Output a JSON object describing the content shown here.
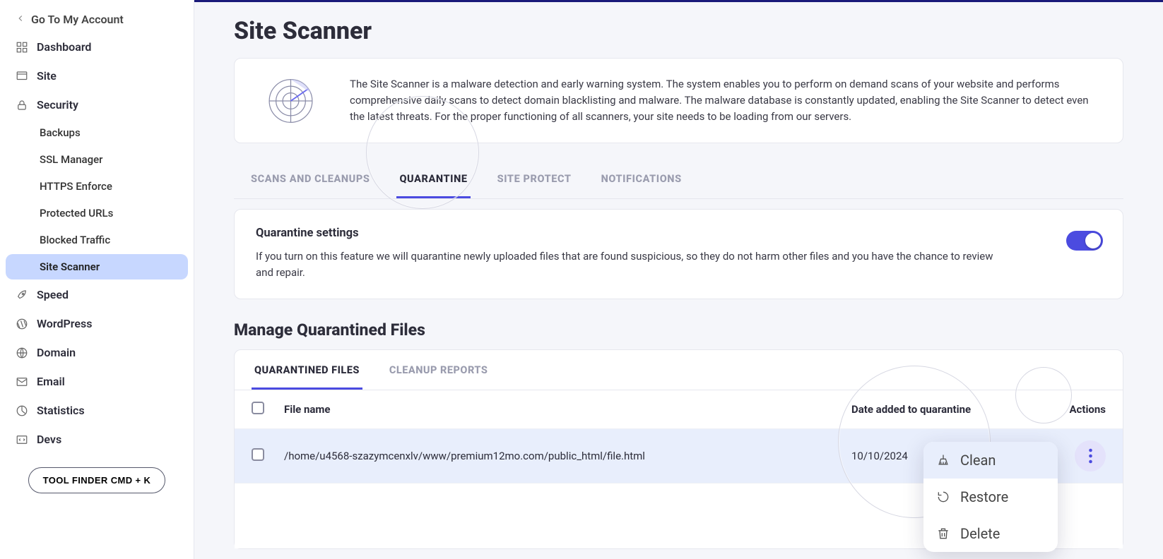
{
  "sidebar": {
    "back_label": "Go To My Account",
    "items": [
      {
        "label": "Dashboard",
        "icon": "grid-icon"
      },
      {
        "label": "Site",
        "icon": "site-icon"
      },
      {
        "label": "Security",
        "icon": "lock-icon"
      },
      {
        "label": "Speed",
        "icon": "rocket-icon"
      },
      {
        "label": "WordPress",
        "icon": "wordpress-icon"
      },
      {
        "label": "Domain",
        "icon": "globe-icon"
      },
      {
        "label": "Email",
        "icon": "mail-icon"
      },
      {
        "label": "Statistics",
        "icon": "chart-icon"
      },
      {
        "label": "Devs",
        "icon": "code-icon"
      }
    ],
    "security_children": [
      {
        "label": "Backups"
      },
      {
        "label": "SSL Manager"
      },
      {
        "label": "HTTPS Enforce"
      },
      {
        "label": "Protected URLs"
      },
      {
        "label": "Blocked Traffic"
      },
      {
        "label": "Site Scanner",
        "active": true
      }
    ],
    "tool_finder": "TOOL FINDER CMD + K"
  },
  "page": {
    "title": "Site Scanner",
    "info": "The Site Scanner is a malware detection and early warning system. The system enables you to perform on demand scans of your website and performs comprehensive daily scans to detect domain blacklisting and malware. The malware database is constantly updated, enabling the Site Scanner to detect even the latest threats. For the proper functioning of all scanners, your site needs to be loading from our servers."
  },
  "tabs": {
    "items": [
      {
        "label": "SCANS AND CLEANUPS"
      },
      {
        "label": "QUARANTINE",
        "active": true
      },
      {
        "label": "SITE PROTECT"
      },
      {
        "label": "NOTIFICATIONS"
      }
    ]
  },
  "quarantine_settings": {
    "heading": "Quarantine settings",
    "description": "If you turn on this feature we will quarantine newly uploaded files that are found suspicious, so they do not harm other files and you have the chance to review and repair.",
    "enabled": true
  },
  "manage": {
    "heading": "Manage Quarantined Files",
    "subtabs": [
      {
        "label": "QUARANTINED FILES",
        "active": true
      },
      {
        "label": "CLEANUP REPORTS"
      }
    ],
    "columns": {
      "file": "File name",
      "date": "Date added to quarantine",
      "actions": "Actions"
    },
    "rows": [
      {
        "file": "/home/u4568-szazymcenxlv/www/premium12mo.com/public_html/file.html",
        "date": "10/10/2024"
      }
    ]
  },
  "dropdown": {
    "items": [
      {
        "label": "Clean",
        "icon": "broom-icon"
      },
      {
        "label": "Restore",
        "icon": "undo-icon"
      },
      {
        "label": "Delete",
        "icon": "trash-icon"
      }
    ]
  }
}
